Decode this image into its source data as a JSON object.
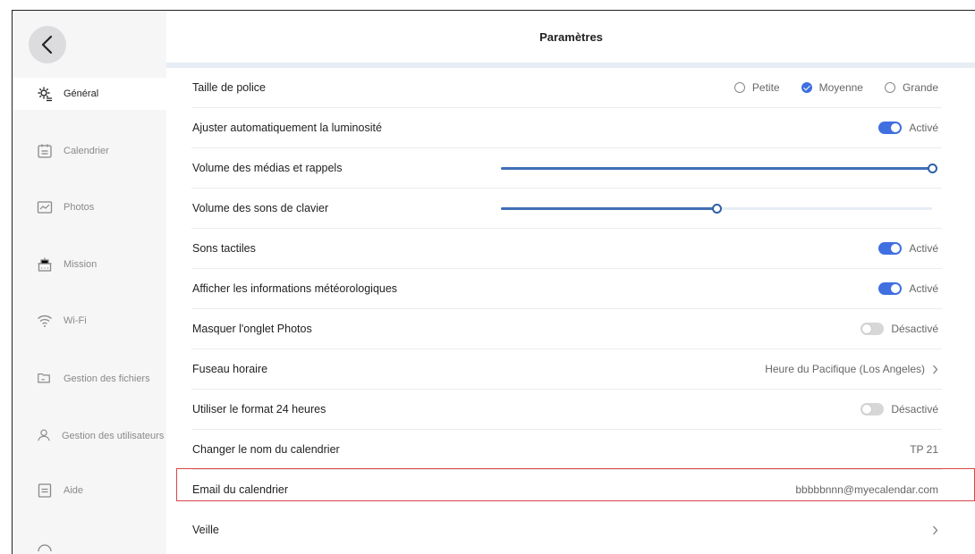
{
  "header": {
    "title": "Paramètres"
  },
  "sidebar": {
    "items": [
      {
        "label": "Général",
        "icon": "settings-icon",
        "active": true
      },
      {
        "label": "Calendrier",
        "icon": "calendar-icon"
      },
      {
        "label": "Photos",
        "icon": "photo-icon"
      },
      {
        "label": "Mission",
        "icon": "mission-icon"
      },
      {
        "label": "Wi-Fi",
        "icon": "wifi-icon"
      },
      {
        "label": "Gestion des fichiers",
        "icon": "folder-icon"
      },
      {
        "label": "Gestion des utilisateurs",
        "icon": "user-icon"
      },
      {
        "label": "Aide",
        "icon": "help-icon"
      }
    ]
  },
  "settings": {
    "font_size": {
      "label": "Taille de police",
      "options": [
        "Petite",
        "Moyenne",
        "Grande"
      ],
      "selected": "Moyenne"
    },
    "auto_brightness": {
      "label": "Ajuster automatiquement la luminosité",
      "value": "Activé"
    },
    "media_volume": {
      "label": "Volume des médias et rappels",
      "level": 1.0
    },
    "keyboard_volume": {
      "label": "Volume des sons de clavier",
      "level": 0.5
    },
    "touch_sounds": {
      "label": "Sons tactiles",
      "value": "Activé"
    },
    "weather_info": {
      "label": "Afficher les informations météorologiques",
      "value": "Activé"
    },
    "hide_photos_tab": {
      "label": "Masquer l'onglet Photos",
      "value": "Désactivé"
    },
    "timezone": {
      "label": "Fuseau horaire",
      "value": "Heure du Pacifique (Los Angeles)"
    },
    "format_24h": {
      "label": "Utiliser le format 24 heures",
      "value": "Désactivé"
    },
    "calendar_name": {
      "label": "Changer le nom du calendrier",
      "value": "TP 21"
    },
    "calendar_email": {
      "label": "Email du calendrier",
      "value": "bbbbbnnn@myecalendar.com"
    },
    "sleep": {
      "label": "Veille"
    }
  },
  "colors": {
    "accent": "#3f6fe0",
    "slider": "#3f6fb5",
    "highlight": "#d9454a"
  }
}
